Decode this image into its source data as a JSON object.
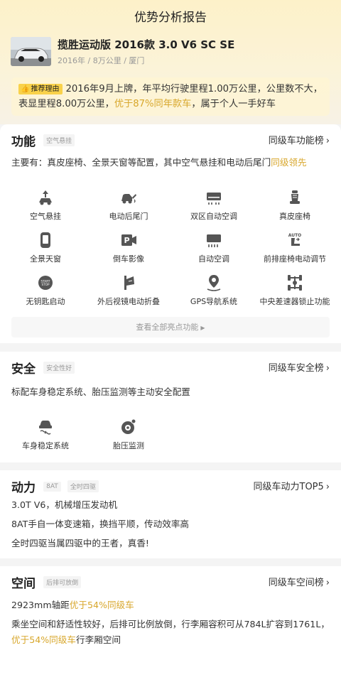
{
  "header": {
    "title": "优势分析报告"
  },
  "car": {
    "name": "揽胜运动版 2016款 3.0 V6 SC SE",
    "meta": "2016年 / 8万公里 / 厦门"
  },
  "recommendation": {
    "badge": "推荐理由",
    "text_before": "2016年9月上牌，年平均行驶里程1.00万公里，公里数不大，表显里程8.00万公里，",
    "highlight": "优于87%同年款车",
    "text_after": "，属于个人一手好车"
  },
  "function": {
    "title": "功能",
    "tag": "空气悬挂",
    "link": "同级车功能榜",
    "summary_before": "主要有：真皮座椅、全景天窗等配置，其中空气悬挂和电动后尾门",
    "summary_highlight": "同级领先",
    "features": [
      {
        "label": "空气悬挂",
        "icon": "air-suspension-icon"
      },
      {
        "label": "电动后尾门",
        "icon": "power-tailgate-icon"
      },
      {
        "label": "双区自动空调",
        "icon": "dual-zone-ac-icon"
      },
      {
        "label": "真皮座椅",
        "icon": "leather-seat-icon"
      },
      {
        "label": "全景天窗",
        "icon": "panoramic-sunroof-icon"
      },
      {
        "label": "倒车影像",
        "icon": "reverse-camera-icon"
      },
      {
        "label": "自动空调",
        "icon": "auto-ac-icon"
      },
      {
        "label": "前排座椅电动调节",
        "icon": "power-seat-icon"
      },
      {
        "label": "无钥匙启动",
        "icon": "keyless-start-icon"
      },
      {
        "label": "外后视镜电动折叠",
        "icon": "mirror-fold-icon"
      },
      {
        "label": "GPS导航系统",
        "icon": "gps-nav-icon"
      },
      {
        "label": "中央差速器锁止功能",
        "icon": "diff-lock-icon"
      }
    ],
    "more_button": "查看全部亮点功能"
  },
  "safety": {
    "title": "安全",
    "tag": "安全性好",
    "link": "同级车安全榜",
    "summary": "标配车身稳定系统、胎压监测等主动安全配置",
    "features": [
      {
        "label": "车身稳定系统",
        "icon": "stability-control-icon"
      },
      {
        "label": "胎压监测",
        "icon": "tire-pressure-icon"
      }
    ]
  },
  "power": {
    "title": "动力",
    "tags": [
      "8AT",
      "全时四驱"
    ],
    "link": "同级车动力TOP5",
    "lines": [
      "3.0T V6，机械增压发动机",
      "8AT手自一体变速箱，换挡平顺，传动效率高",
      "全时四驱当属四驱中的王者，真香!"
    ]
  },
  "space": {
    "title": "空间",
    "tag": "后排可放倒",
    "link": "同级车空间榜",
    "line1_before": "2923mm轴距",
    "line1_highlight": "优于54%同级车",
    "line2_before": "乘坐空间和舒适性较好，后排可比例放倒，行李厢容积可从784L扩容到1761L，",
    "line2_highlight": "优于54%同级车",
    "line2_after": "行李厢空间"
  },
  "colors": {
    "accent": "#d8a72c",
    "badge": "#f9d24a",
    "icon": "#555555"
  }
}
